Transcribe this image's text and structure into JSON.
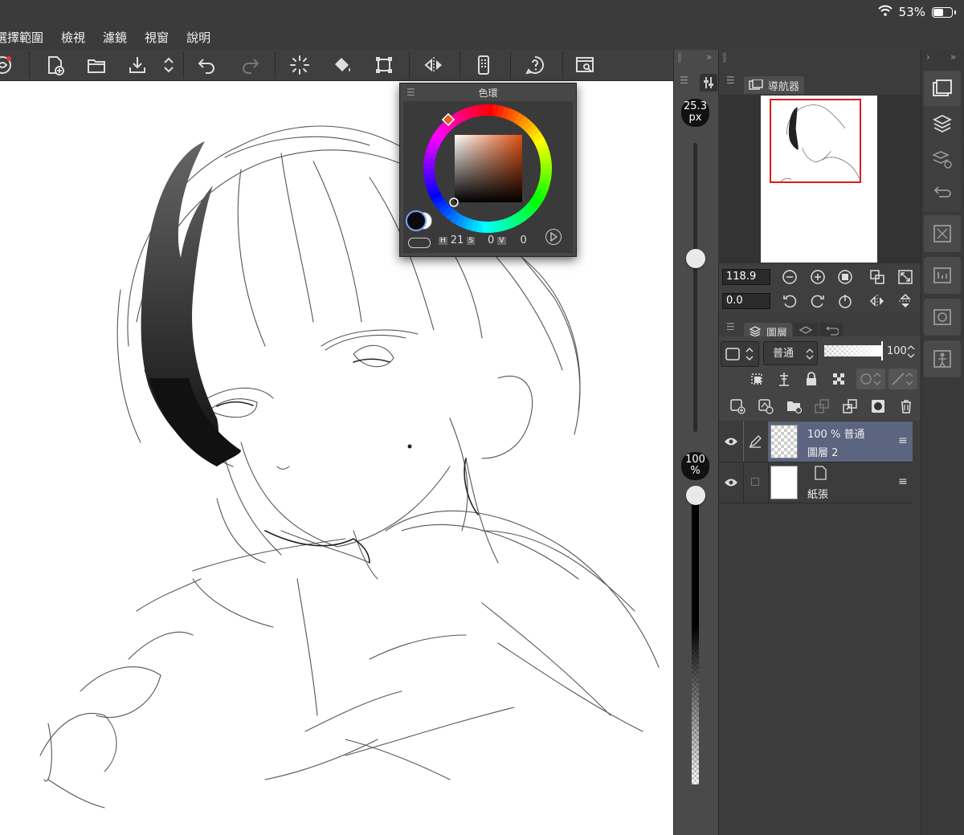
{
  "status": {
    "battery_text": "53%",
    "battery_level": 0.53
  },
  "menu": [
    "選擇範圍",
    "檢視",
    "濾鏡",
    "視窗",
    "說明"
  ],
  "toolbar": {
    "icons": [
      "app-logo-icon",
      "new-file-icon",
      "open-folder-icon",
      "save-icon",
      "stepper-icon",
      "undo-icon",
      "redo-icon",
      "loading-spinner-icon",
      "fill-icon",
      "transform-icon",
      "flip-horizontal-icon",
      "remote-icon",
      "help-icon",
      "settings-icon"
    ]
  },
  "brush": {
    "size_value": "25.3",
    "size_unit": "px",
    "size_level": 0.6,
    "opacity_value": "100",
    "opacity_unit": "%",
    "opacity_level": 1.0
  },
  "navigator": {
    "tab_label": "導航器",
    "zoom_value": "118.9",
    "rotate_value": "0.0"
  },
  "color_wheel": {
    "title": "色環",
    "h_label": "H",
    "h_value": "21",
    "s_label": "S",
    "s_value": "0",
    "v_label": "V",
    "v_value": "0",
    "main_color": "#0a0a0a",
    "sub_color": "#ffffff",
    "hue_color": "#e06020"
  },
  "layers": {
    "tab_label": "圖層",
    "blend_mode": "普通",
    "opacity": "100",
    "rows": [
      {
        "top_text": "100 %  普通",
        "name": "圖層 2",
        "selected": true
      },
      {
        "top_text": "",
        "name": "紙張",
        "selected": false
      }
    ]
  }
}
